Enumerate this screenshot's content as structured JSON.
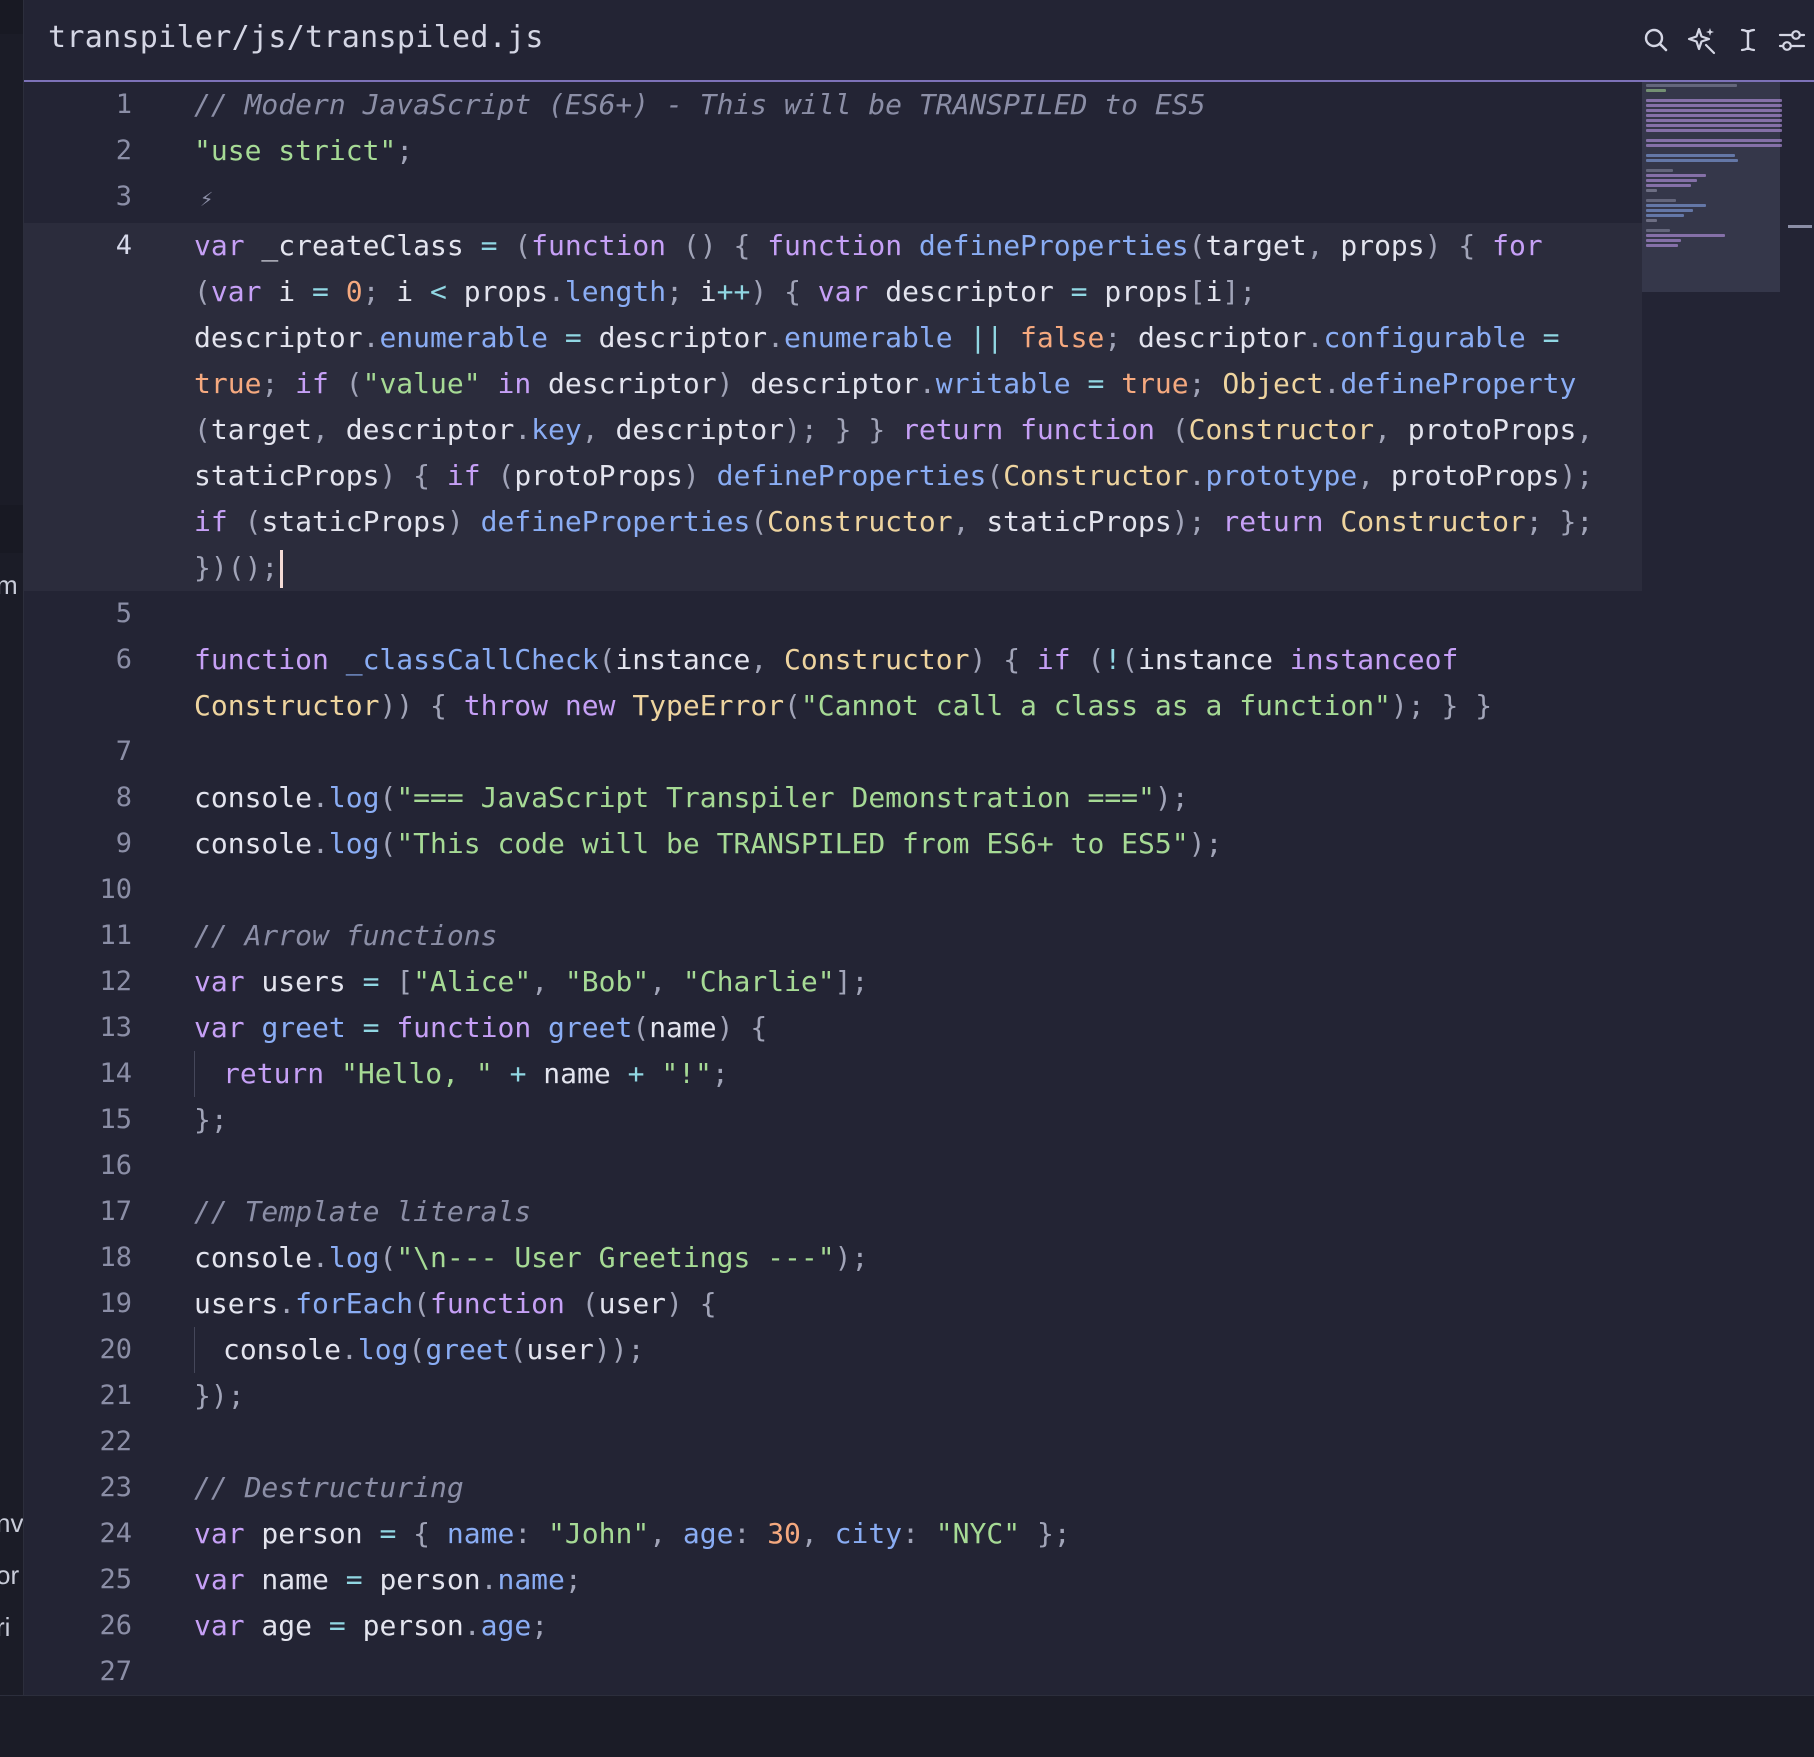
{
  "editor": {
    "file_path": "transpiler/js/transpiled.js",
    "active_line": 4
  },
  "toolbar": {
    "icons": [
      "search-icon",
      "sparkle-icon",
      "text-cursor-icon",
      "sliders-icon"
    ]
  },
  "sidebar_fragments": [
    "m",
    "nv",
    "or",
    "ri"
  ],
  "theme": {
    "background": "#232434",
    "keyword": "#c6a0f6",
    "string": "#a6da95",
    "number": "#f5a97f",
    "comment": "#8b8ea6",
    "function": "#8aadf4",
    "class": "#eed49f",
    "accent": "#7d72b8"
  },
  "code": {
    "lines": [
      [
        [
          "c",
          "// Modern JavaScript (ES6+) - This will be TRANSPILED to ES5"
        ]
      ],
      [
        [
          "s",
          "\"use strict\""
        ],
        [
          "p",
          ";"
        ]
      ],
      [],
      [
        [
          "k",
          "var"
        ],
        [
          "t",
          " _createClass "
        ],
        [
          "o",
          "="
        ],
        [
          "t",
          " "
        ],
        [
          "p",
          "("
        ],
        [
          "k",
          "function"
        ],
        [
          "t",
          " "
        ],
        [
          "p",
          "()"
        ],
        [
          "t",
          " "
        ],
        [
          "p",
          "{"
        ],
        [
          "t",
          " "
        ],
        [
          "k",
          "function"
        ],
        [
          "t",
          " "
        ],
        [
          "f",
          "defineProperties"
        ],
        [
          "p",
          "("
        ],
        [
          "t",
          "target"
        ],
        [
          "p",
          ","
        ],
        [
          "t",
          " props"
        ],
        [
          "p",
          ")"
        ],
        [
          "t",
          " "
        ],
        [
          "p",
          "{"
        ],
        [
          "t",
          " "
        ],
        [
          "k",
          "for"
        ],
        [
          "t",
          " "
        ],
        [
          "p",
          "("
        ],
        [
          "k",
          "var"
        ],
        [
          "t",
          " i "
        ],
        [
          "o",
          "="
        ],
        [
          "t",
          " "
        ],
        [
          "n",
          "0"
        ],
        [
          "p",
          ";"
        ],
        [
          "t",
          " i "
        ],
        [
          "o",
          "<"
        ],
        [
          "t",
          " props"
        ],
        [
          "p",
          "."
        ],
        [
          "pr",
          "length"
        ],
        [
          "p",
          ";"
        ],
        [
          "t",
          " i"
        ],
        [
          "o",
          "++"
        ],
        [
          "p",
          ")"
        ],
        [
          "t",
          " "
        ],
        [
          "p",
          "{"
        ],
        [
          "t",
          " "
        ],
        [
          "k",
          "var"
        ],
        [
          "t",
          " descriptor "
        ],
        [
          "o",
          "="
        ],
        [
          "t",
          " props"
        ],
        [
          "p",
          "["
        ],
        [
          "t",
          "i"
        ],
        [
          "p",
          "]"
        ],
        [
          "p",
          ";"
        ],
        [
          "t",
          " descriptor"
        ],
        [
          "p",
          "."
        ],
        [
          "pr",
          "enumerable"
        ],
        [
          "t",
          " "
        ],
        [
          "o",
          "="
        ],
        [
          "t",
          " descriptor"
        ],
        [
          "p",
          "."
        ],
        [
          "pr",
          "enumerable"
        ],
        [
          "t",
          " "
        ],
        [
          "o",
          "||"
        ],
        [
          "t",
          " "
        ],
        [
          "n",
          "false"
        ],
        [
          "p",
          ";"
        ],
        [
          "t",
          " descriptor"
        ],
        [
          "p",
          "."
        ],
        [
          "pr",
          "configurable"
        ],
        [
          "t",
          " "
        ],
        [
          "o",
          "="
        ],
        [
          "t",
          " "
        ],
        [
          "n",
          "true"
        ],
        [
          "p",
          ";"
        ],
        [
          "t",
          " "
        ],
        [
          "k",
          "if"
        ],
        [
          "t",
          " "
        ],
        [
          "p",
          "("
        ],
        [
          "s",
          "\"value\""
        ],
        [
          "t",
          " "
        ],
        [
          "k",
          "in"
        ],
        [
          "t",
          " descriptor"
        ],
        [
          "p",
          ")"
        ],
        [
          "t",
          " descriptor"
        ],
        [
          "p",
          "."
        ],
        [
          "pr",
          "writable"
        ],
        [
          "t",
          " "
        ],
        [
          "o",
          "="
        ],
        [
          "t",
          " "
        ],
        [
          "n",
          "true"
        ],
        [
          "p",
          ";"
        ],
        [
          "t",
          " "
        ],
        [
          "y",
          "Object"
        ],
        [
          "p",
          "."
        ],
        [
          "f",
          "defineProperty"
        ],
        [
          "t",
          " "
        ],
        [
          "p",
          "("
        ],
        [
          "t",
          "target"
        ],
        [
          "p",
          ","
        ],
        [
          "t",
          " descriptor"
        ],
        [
          "p",
          "."
        ],
        [
          "pr",
          "key"
        ],
        [
          "p",
          ","
        ],
        [
          "t",
          " descriptor"
        ],
        [
          "p",
          ");"
        ],
        [
          "t",
          " "
        ],
        [
          "p",
          "}"
        ],
        [
          "t",
          " "
        ],
        [
          "p",
          "}"
        ],
        [
          "t",
          " "
        ],
        [
          "k",
          "return"
        ],
        [
          "t",
          " "
        ],
        [
          "k",
          "function"
        ],
        [
          "t",
          " "
        ],
        [
          "p",
          "("
        ],
        [
          "y",
          "Constructor"
        ],
        [
          "p",
          ","
        ],
        [
          "t",
          " protoProps"
        ],
        [
          "p",
          ","
        ],
        [
          "t",
          " staticProps"
        ],
        [
          "p",
          ")"
        ],
        [
          "t",
          " "
        ],
        [
          "p",
          "{"
        ],
        [
          "t",
          " "
        ],
        [
          "k",
          "if"
        ],
        [
          "t",
          " "
        ],
        [
          "p",
          "("
        ],
        [
          "t",
          "protoProps"
        ],
        [
          "p",
          ")"
        ],
        [
          "t",
          " "
        ],
        [
          "f",
          "defineProperties"
        ],
        [
          "p",
          "("
        ],
        [
          "y",
          "Constructor"
        ],
        [
          "p",
          "."
        ],
        [
          "pr",
          "prototype"
        ],
        [
          "p",
          ","
        ],
        [
          "t",
          " protoProps"
        ],
        [
          "p",
          ");"
        ],
        [
          "t",
          " "
        ],
        [
          "k",
          "if"
        ],
        [
          "t",
          " "
        ],
        [
          "p",
          "("
        ],
        [
          "t",
          "staticProps"
        ],
        [
          "p",
          ")"
        ],
        [
          "t",
          " "
        ],
        [
          "f",
          "defineProperties"
        ],
        [
          "p",
          "("
        ],
        [
          "y",
          "Constructor"
        ],
        [
          "p",
          ","
        ],
        [
          "t",
          " staticProps"
        ],
        [
          "p",
          ");"
        ],
        [
          "t",
          " "
        ],
        [
          "k",
          "return"
        ],
        [
          "t",
          " "
        ],
        [
          "y",
          "Constructor"
        ],
        [
          "p",
          ";"
        ],
        [
          "t",
          " "
        ],
        [
          "p",
          "};"
        ],
        [
          "t",
          " "
        ],
        [
          "p",
          "})();"
        ]
      ],
      [],
      [
        [
          "k",
          "function"
        ],
        [
          "t",
          " "
        ],
        [
          "f",
          "_classCallCheck"
        ],
        [
          "p",
          "("
        ],
        [
          "t",
          "instance"
        ],
        [
          "p",
          ","
        ],
        [
          "t",
          " "
        ],
        [
          "y",
          "Constructor"
        ],
        [
          "p",
          ")"
        ],
        [
          "t",
          " "
        ],
        [
          "p",
          "{"
        ],
        [
          "t",
          " "
        ],
        [
          "k",
          "if"
        ],
        [
          "t",
          " "
        ],
        [
          "p",
          "("
        ],
        [
          "o",
          "!"
        ],
        [
          "p",
          "("
        ],
        [
          "t",
          "instance "
        ],
        [
          "k",
          "instanceof"
        ],
        [
          "t",
          " "
        ],
        [
          "y",
          "Constructor"
        ],
        [
          "p",
          "))"
        ],
        [
          "t",
          " "
        ],
        [
          "p",
          "{"
        ],
        [
          "t",
          " "
        ],
        [
          "k",
          "throw"
        ],
        [
          "t",
          " "
        ],
        [
          "k",
          "new"
        ],
        [
          "t",
          " "
        ],
        [
          "y",
          "TypeError"
        ],
        [
          "p",
          "("
        ],
        [
          "s",
          "\"Cannot call a class as a function\""
        ],
        [
          "p",
          ");"
        ],
        [
          "t",
          " "
        ],
        [
          "p",
          "}"
        ],
        [
          "t",
          " "
        ],
        [
          "p",
          "}"
        ]
      ],
      [],
      [
        [
          "t",
          "console"
        ],
        [
          "p",
          "."
        ],
        [
          "f",
          "log"
        ],
        [
          "p",
          "("
        ],
        [
          "s",
          "\"=== JavaScript Transpiler Demonstration ===\""
        ],
        [
          "p",
          ");"
        ]
      ],
      [
        [
          "t",
          "console"
        ],
        [
          "p",
          "."
        ],
        [
          "f",
          "log"
        ],
        [
          "p",
          "("
        ],
        [
          "s",
          "\"This code will be TRANSPILED from ES6+ to ES5\""
        ],
        [
          "p",
          ");"
        ]
      ],
      [],
      [
        [
          "c",
          "// Arrow functions"
        ]
      ],
      [
        [
          "k",
          "var"
        ],
        [
          "t",
          " users "
        ],
        [
          "o",
          "="
        ],
        [
          "t",
          " "
        ],
        [
          "p",
          "["
        ],
        [
          "s",
          "\"Alice\""
        ],
        [
          "p",
          ","
        ],
        [
          "t",
          " "
        ],
        [
          "s",
          "\"Bob\""
        ],
        [
          "p",
          ","
        ],
        [
          "t",
          " "
        ],
        [
          "s",
          "\"Charlie\""
        ],
        [
          "p",
          "];"
        ]
      ],
      [
        [
          "k",
          "var"
        ],
        [
          "t",
          " "
        ],
        [
          "f",
          "greet"
        ],
        [
          "t",
          " "
        ],
        [
          "o",
          "="
        ],
        [
          "t",
          " "
        ],
        [
          "k",
          "function"
        ],
        [
          "t",
          " "
        ],
        [
          "f",
          "greet"
        ],
        [
          "p",
          "("
        ],
        [
          "t",
          "name"
        ],
        [
          "p",
          ")"
        ],
        [
          "t",
          " "
        ],
        [
          "p",
          "{"
        ]
      ],
      [
        [
          "i",
          ""
        ],
        [
          "k",
          "return"
        ],
        [
          "t",
          " "
        ],
        [
          "s",
          "\"Hello, \""
        ],
        [
          "t",
          " "
        ],
        [
          "o",
          "+"
        ],
        [
          "t",
          " name "
        ],
        [
          "o",
          "+"
        ],
        [
          "t",
          " "
        ],
        [
          "s",
          "\"!\""
        ],
        [
          "p",
          ";"
        ]
      ],
      [
        [
          "p",
          "};"
        ]
      ],
      [],
      [
        [
          "c",
          "// Template literals"
        ]
      ],
      [
        [
          "t",
          "console"
        ],
        [
          "p",
          "."
        ],
        [
          "f",
          "log"
        ],
        [
          "p",
          "("
        ],
        [
          "s",
          "\"\\n--- User Greetings ---\""
        ],
        [
          "p",
          ");"
        ]
      ],
      [
        [
          "t",
          "users"
        ],
        [
          "p",
          "."
        ],
        [
          "f",
          "forEach"
        ],
        [
          "p",
          "("
        ],
        [
          "k",
          "function"
        ],
        [
          "t",
          " "
        ],
        [
          "p",
          "("
        ],
        [
          "t",
          "user"
        ],
        [
          "p",
          ")"
        ],
        [
          "t",
          " "
        ],
        [
          "p",
          "{"
        ]
      ],
      [
        [
          "i",
          ""
        ],
        [
          "t",
          "console"
        ],
        [
          "p",
          "."
        ],
        [
          "f",
          "log"
        ],
        [
          "p",
          "("
        ],
        [
          "f",
          "greet"
        ],
        [
          "p",
          "("
        ],
        [
          "t",
          "user"
        ],
        [
          "p",
          "));"
        ]
      ],
      [
        [
          "p",
          "});"
        ]
      ],
      [],
      [
        [
          "c",
          "// Destructuring"
        ]
      ],
      [
        [
          "k",
          "var"
        ],
        [
          "t",
          " person "
        ],
        [
          "o",
          "="
        ],
        [
          "t",
          " "
        ],
        [
          "p",
          "{"
        ],
        [
          "t",
          " "
        ],
        [
          "pr",
          "name"
        ],
        [
          "p",
          ":"
        ],
        [
          "t",
          " "
        ],
        [
          "s",
          "\"John\""
        ],
        [
          "p",
          ","
        ],
        [
          "t",
          " "
        ],
        [
          "pr",
          "age"
        ],
        [
          "p",
          ":"
        ],
        [
          "t",
          " "
        ],
        [
          "n",
          "30"
        ],
        [
          "p",
          ","
        ],
        [
          "t",
          " "
        ],
        [
          "pr",
          "city"
        ],
        [
          "p",
          ":"
        ],
        [
          "t",
          " "
        ],
        [
          "s",
          "\"NYC\""
        ],
        [
          "t",
          " "
        ],
        [
          "p",
          "};"
        ]
      ],
      [
        [
          "k",
          "var"
        ],
        [
          "t",
          " name "
        ],
        [
          "o",
          "="
        ],
        [
          "t",
          " person"
        ],
        [
          "p",
          "."
        ],
        [
          "pr",
          "name"
        ],
        [
          "p",
          ";"
        ]
      ],
      [
        [
          "k",
          "var"
        ],
        [
          "t",
          " age "
        ],
        [
          "o",
          "="
        ],
        [
          "t",
          " person"
        ],
        [
          "p",
          "."
        ],
        [
          "pr",
          "age"
        ],
        [
          "p",
          ";"
        ]
      ],
      []
    ]
  }
}
